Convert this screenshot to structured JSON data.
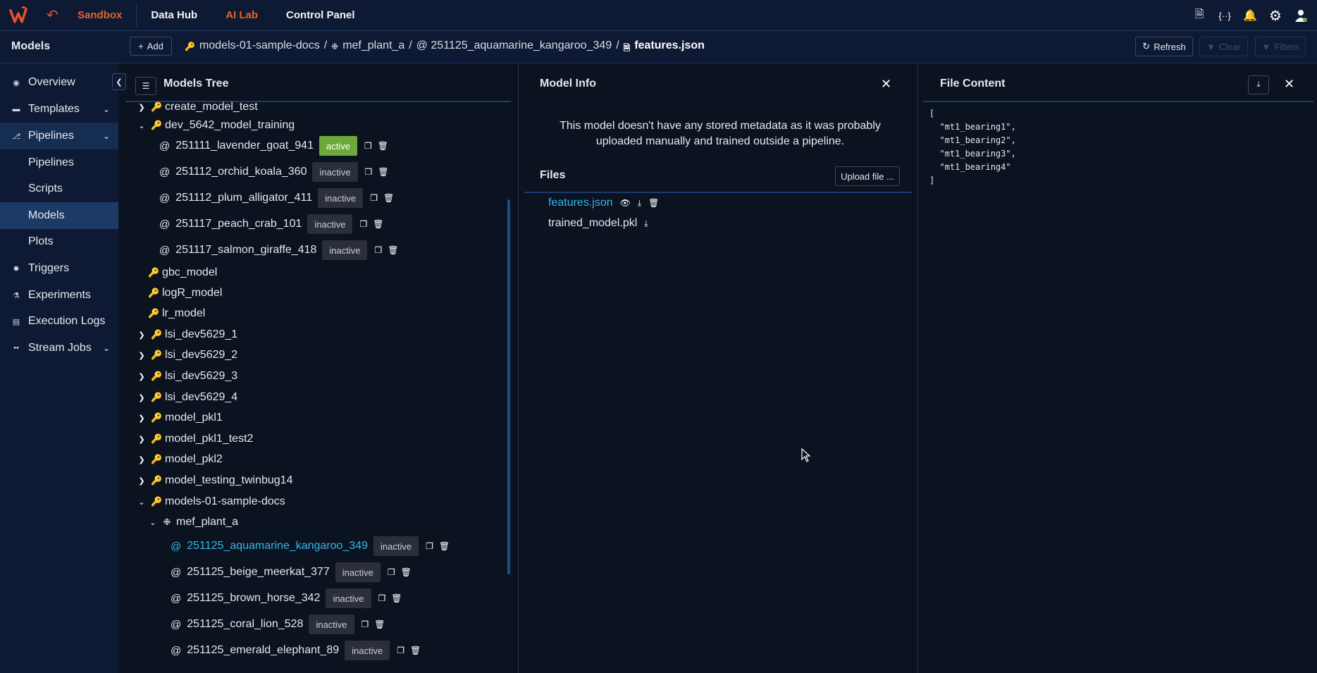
{
  "topbar": {
    "back_icon": "undo-arrow-icon",
    "nav": [
      "Sandbox",
      "Data Hub",
      "AI Lab",
      "Control Panel"
    ],
    "icons": [
      "file-code-icon",
      "braces-icon",
      "bell-icon",
      "gear-icon",
      "user-icon"
    ]
  },
  "subbar": {
    "title": "Models",
    "add_label": "Add",
    "breadcrumb": [
      "models-01-sample-docs",
      "/",
      "mef_plant_a",
      "/",
      "@ 251125_aquamarine_kangaroo_349",
      "/",
      "features.json"
    ],
    "refresh_label": "Refresh",
    "clear_label": "Clear",
    "filters_label": "Filters"
  },
  "sidebar": {
    "items": [
      {
        "label": "Overview",
        "icon": "overview-icon"
      },
      {
        "label": "Templates",
        "icon": "template-icon"
      },
      {
        "label": "Pipelines",
        "icon": "pipeline-icon"
      },
      {
        "label": "Pipelines"
      },
      {
        "label": "Scripts"
      },
      {
        "label": "Models"
      },
      {
        "label": "Plots"
      },
      {
        "label": "Triggers",
        "icon": "trigger-icon"
      },
      {
        "label": "Experiments",
        "icon": "flask-icon"
      },
      {
        "label": "Execution Logs",
        "icon": "logs-icon"
      },
      {
        "label": "Stream Jobs",
        "icon": "stream-icon"
      }
    ]
  },
  "tree": {
    "title": "Models Tree",
    "rows": [
      {
        "label": "create_model_test"
      },
      {
        "label": "dev_5642_model_training"
      },
      {
        "label": "251111_lavender_goat_941",
        "status": "active"
      },
      {
        "label": "251112_orchid_koala_360",
        "status": "inactive"
      },
      {
        "label": "251112_plum_alligator_411",
        "status": "inactive"
      },
      {
        "label": "251117_peach_crab_101",
        "status": "inactive"
      },
      {
        "label": "251117_salmon_giraffe_418",
        "status": "inactive"
      },
      {
        "label": "gbc_model"
      },
      {
        "label": "logR_model"
      },
      {
        "label": "lr_model"
      },
      {
        "label": "lsi_dev5629_1"
      },
      {
        "label": "lsi_dev5629_2"
      },
      {
        "label": "lsi_dev5629_3"
      },
      {
        "label": "lsi_dev5629_4"
      },
      {
        "label": "model_pkl1"
      },
      {
        "label": "model_pkl1_test2"
      },
      {
        "label": "model_pkl2"
      },
      {
        "label": "model_testing_twinbug14"
      },
      {
        "label": "models-01-sample-docs"
      },
      {
        "label": "mef_plant_a"
      },
      {
        "label": "251125_aquamarine_kangaroo_349",
        "status": "inactive"
      },
      {
        "label": "251125_beige_meerkat_377",
        "status": "inactive"
      },
      {
        "label": "251125_brown_horse_342",
        "status": "inactive"
      },
      {
        "label": "251125_coral_lion_528",
        "status": "inactive"
      },
      {
        "label": "251125_emerald_elephant_89",
        "status": "inactive"
      }
    ]
  },
  "model_info": {
    "title": "Model Info",
    "note": "This model doesn't have any stored metadata as it was probably uploaded manually and trained outside a pipeline.",
    "files_heading": "Files",
    "upload_label": "Upload file ...",
    "files": [
      "features.json",
      "trained_model.pkl"
    ]
  },
  "file_content": {
    "title": "File Content",
    "text": "[\n  \"mt1_bearing1\",\n  \"mt1_bearing2\",\n  \"mt1_bearing3\",\n  \"mt1_bearing4\"\n]"
  },
  "colors": {
    "accent": "#e8612a",
    "link": "#35b8e8",
    "active_badge": "#6eaa3a",
    "bg": "#0b1220"
  }
}
